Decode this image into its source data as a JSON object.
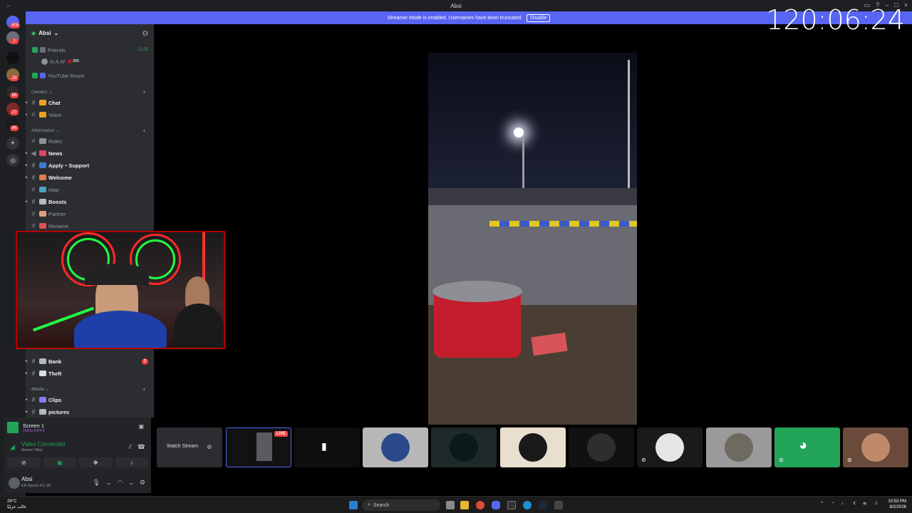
{
  "window": {
    "title": "Absi",
    "back_icon": "back-arrow-icon"
  },
  "banner": {
    "text": "Streamer Mode is enabled. Usernames have been truncated.",
    "button": "Disable"
  },
  "timer": "120:06:24",
  "rail": {
    "badges": [
      "408",
      "1",
      "29",
      "68",
      "27",
      "86"
    ]
  },
  "server": {
    "name": "Absi"
  },
  "channels": {
    "friends": {
      "label": "Friends",
      "time": "21:05"
    },
    "user_row": {
      "name": "N.A.M",
      "tag": "385"
    },
    "youtube": "YouTube Room",
    "owners_cat": "Owners",
    "chat": "Chat",
    "voice": "Voice",
    "info_cat": "Information",
    "rules": "Rules",
    "news": "News",
    "apply": "Apply・Support",
    "welcome": "Welcome",
    "map": "Map",
    "boosts": "Boosts",
    "partner": "Partner",
    "rename": "Rename",
    "bank": "Bank",
    "bank_badge": "2",
    "theft": "Theft",
    "media_cat": "Media",
    "clips": "Clips",
    "pictures": "pictures"
  },
  "voice_panel": {
    "screen_title": "Screen 1",
    "screen_sub": "1080p 60FPS",
    "status": "Video Connected",
    "channel": "Meow / Absi"
  },
  "user_panel": {
    "name": "Absi",
    "activity": "EA Sports FC 26"
  },
  "tiles": {
    "watch_stream": "Watch Stream",
    "live": "LIVE"
  },
  "taskbar": {
    "weather_temp": "28°C",
    "weather_desc": "غالب جزئيًا",
    "search": "Search",
    "time": "10:53 PM",
    "date": "8/2/2026"
  },
  "colors": {
    "accent": "#5865f2",
    "online": "#23a559",
    "alert": "#f23f42"
  }
}
